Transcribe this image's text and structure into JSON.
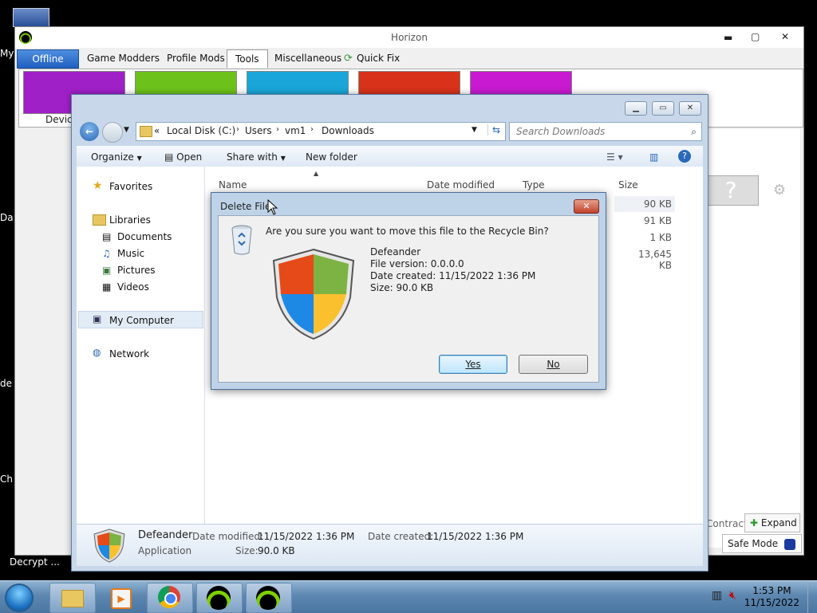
{
  "desktop": {
    "labels": [
      "My",
      "Da",
      "de",
      "Ch",
      "Decrypt ..."
    ]
  },
  "horizon": {
    "title": "Horizon",
    "tabs": [
      "Offline",
      "Game Modders",
      "Profile Mods",
      "Tools",
      "Miscellaneous",
      "Quick Fix"
    ],
    "tile_label": "Device",
    "right_buttons": {
      "contract": "Contract",
      "expand": "Expand",
      "safe_mode": "Safe Mode"
    },
    "tile_colors": [
      "#a020c8",
      "#6cc21a",
      "#1aa6d8",
      "#d8321a",
      "#c81ad0"
    ]
  },
  "explorer": {
    "breadcrumb": [
      "Local Disk (C:)",
      "Users",
      "vm1",
      "Downloads"
    ],
    "breadcrumb_prefix": "«",
    "search_placeholder": "Search Downloads",
    "toolbar": {
      "organize": "Organize",
      "open": "Open",
      "share_with": "Share with",
      "new_folder": "New folder"
    },
    "nav": {
      "favorites": "Favorites",
      "libraries": "Libraries",
      "documents": "Documents",
      "music": "Music",
      "pictures": "Pictures",
      "videos": "Videos",
      "my_computer": "My Computer",
      "network": "Network"
    },
    "columns": {
      "name": "Name",
      "date_modified": "Date modified",
      "type": "Type",
      "size": "Size"
    },
    "sizes": [
      "90 KB",
      "91 KB",
      "1 KB",
      "13,645 KB"
    ],
    "details": {
      "name": "Defeander",
      "type": "Application",
      "date_modified_label": "Date modified:",
      "date_modified": "11/15/2022 1:36 PM",
      "size_label": "Size:",
      "size": "90.0 KB",
      "date_created_label": "Date created:",
      "date_created": "11/15/2022 1:36 PM"
    }
  },
  "dialog": {
    "title": "Delete File",
    "question": "Are you sure you want to move this file to the Recycle Bin?",
    "file_name": "Defeander",
    "file_version": "File version: 0.0.0.0",
    "date_created": "Date created: 11/15/2022 1:36 PM",
    "size": "Size: 90.0 KB",
    "yes": "Yes",
    "no": "No"
  },
  "taskbar": {
    "time": "1:53 PM",
    "date": "11/15/2022"
  }
}
